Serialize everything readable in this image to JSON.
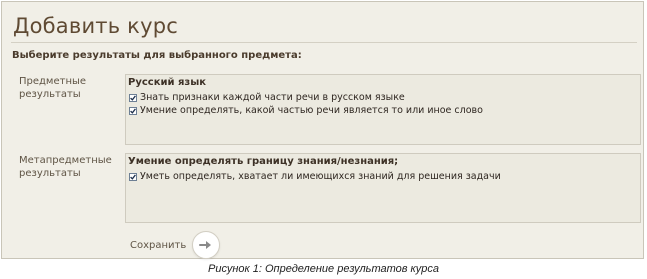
{
  "page": {
    "title": "Добавить курс",
    "subheading": "Выберите результаты для выбранного предмета:"
  },
  "subject_results": {
    "label": "Предметные результаты",
    "group_title": "Русский язык",
    "items": [
      {
        "label": "Знать признаки каждой части речи в русском языке",
        "checked": true
      },
      {
        "label": "Умение определять, какой частью речи является то или иное слово",
        "checked": true
      }
    ]
  },
  "meta_results": {
    "label": "Метапредметные результаты",
    "group_title": "Умение определять границу знания/незнания;",
    "items": [
      {
        "label": "Уметь определять, хватает ли имеющихся знаний для решения задачи",
        "checked": true
      }
    ]
  },
  "actions": {
    "save_label": "Сохранить",
    "save_icon": "arrow-right-icon"
  },
  "caption": "Рисунок 1: Определение результатов курса"
}
